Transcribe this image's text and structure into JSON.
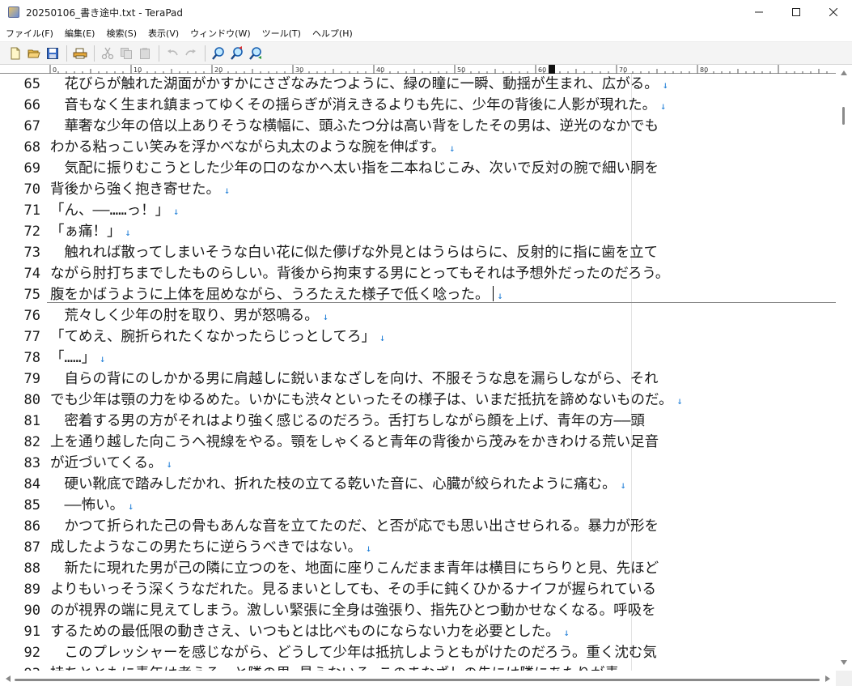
{
  "window": {
    "title": "20250106_書き途中.txt - TeraPad",
    "icon": "terapad-app-icon",
    "controls": [
      "minimize-icon",
      "maximize-icon",
      "close-icon"
    ]
  },
  "menu": [
    {
      "label": "ファイル(F)"
    },
    {
      "label": "編集(E)"
    },
    {
      "label": "検索(S)"
    },
    {
      "label": "表示(V)"
    },
    {
      "label": "ウィンドウ(W)"
    },
    {
      "label": "ツール(T)"
    },
    {
      "label": "ヘルプ(H)"
    }
  ],
  "toolbar": [
    {
      "icon": "new-file-icon",
      "enabled": true
    },
    {
      "icon": "open-folder-icon",
      "enabled": true
    },
    {
      "icon": "save-icon",
      "enabled": true
    },
    {
      "icon": "print-icon",
      "enabled": true
    },
    {
      "icon": "cut-icon",
      "enabled": false
    },
    {
      "icon": "copy-icon",
      "enabled": false
    },
    {
      "icon": "paste-icon",
      "enabled": false
    },
    {
      "icon": "undo-icon",
      "enabled": false
    },
    {
      "icon": "redo-icon",
      "enabled": false
    },
    {
      "icon": "search-icon",
      "enabled": true
    },
    {
      "icon": "search-previous-icon",
      "enabled": true
    },
    {
      "icon": "search-next-icon",
      "enabled": true
    }
  ],
  "ruler": {
    "labels": [
      "0",
      "10",
      "20",
      "30",
      "40",
      "50",
      "60",
      "70",
      "80"
    ],
    "marker_column": 62
  },
  "editor": {
    "newline_mark": "↓",
    "cursor_line": 75,
    "wrap_column": 72,
    "lines": [
      {
        "num": "65",
        "text": "　花びらが触れた湖面がかすかにさざなみたつように、緑の瞳に一瞬、動揺が生まれ、広がる。",
        "nl": true
      },
      {
        "num": "66",
        "text": "　音もなく生まれ鎮まってゆくその揺らぎが消えきるよりも先に、少年の背後に人影が現れた。",
        "nl": true
      },
      {
        "num": "67",
        "text": "　華奢な少年の倍以上ありそうな横幅に、頭ふたつ分は高い背をしたその男は、逆光のなかでも",
        "nl": false
      },
      {
        "num": "68",
        "text": "わかる粘っこい笑みを浮かべながら丸太のような腕を伸ばす。",
        "nl": true
      },
      {
        "num": "69",
        "text": "　気配に振りむこうとした少年の口のなかへ太い指を二本ねじこみ、次いで反対の腕で細い胴を",
        "nl": false
      },
      {
        "num": "70",
        "text": "背後から強く抱き寄せた。",
        "nl": true
      },
      {
        "num": "71",
        "text": "「ん、――……っ！」",
        "nl": true
      },
      {
        "num": "72",
        "text": "「ぁ痛！」",
        "nl": true
      },
      {
        "num": "73",
        "text": "　触れれば散ってしまいそうな白い花に似た儚げな外見とはうらはらに、反射的に指に歯を立て",
        "nl": false
      },
      {
        "num": "74",
        "text": "ながら肘打ちまでしたものらしい。背後から拘束する男にとってもそれは予想外だったのだろう。",
        "nl": false
      },
      {
        "num": "75",
        "text": "腹をかばうように上体を屈めながら、うろたえた様子で低く唸った。",
        "nl": true
      },
      {
        "num": "76",
        "text": "　荒々しく少年の肘を取り、男が怒鳴る。",
        "nl": true
      },
      {
        "num": "77",
        "text": "「てめえ、腕折られたくなかったらじっとしてろ」",
        "nl": true
      },
      {
        "num": "78",
        "text": "「……」",
        "nl": true
      },
      {
        "num": "79",
        "text": "　自らの背にのしかかる男に肩越しに鋭いまなざしを向け、不服そうな息を漏らしながら、それ",
        "nl": false
      },
      {
        "num": "80",
        "text": "でも少年は顎の力をゆるめた。いかにも渋々といったその様子は、いまだ抵抗を諦めないものだ。",
        "nl": true
      },
      {
        "num": "81",
        "text": "　密着する男の方がそれはより強く感じるのだろう。舌打ちしながら顔を上げ、青年の方――頭",
        "nl": false
      },
      {
        "num": "82",
        "text": "上を通り越した向こうへ視線をやる。顎をしゃくると青年の背後から茂みをかきわける荒い足音",
        "nl": false
      },
      {
        "num": "83",
        "text": "が近づいてくる。",
        "nl": true
      },
      {
        "num": "84",
        "text": "　硬い靴底で踏みしだかれ、折れた枝の立てる乾いた音に、心臓が絞られたように痛む。",
        "nl": true
      },
      {
        "num": "85",
        "text": "　――怖い。",
        "nl": true
      },
      {
        "num": "86",
        "text": "　かつて折られた己の骨もあんな音を立てたのだ、と否が応でも思い出させられる。暴力が形を",
        "nl": false
      },
      {
        "num": "87",
        "text": "成したようなこの男たちに逆らうべきではない。",
        "nl": true
      },
      {
        "num": "88",
        "text": "　新たに現れた男が己の隣に立つのを、地面に座りこんだまま青年は横目にちらりと見、先ほど",
        "nl": false
      },
      {
        "num": "89",
        "text": "よりもいっそう深くうなだれた。見るまいとしても、その手に鈍くひかるナイフが握られている",
        "nl": false
      },
      {
        "num": "90",
        "text": "のが視界の端に見えてしまう。激しい緊張に全身は強張り、指先ひとつ動かせなくなる。呼吸を",
        "nl": false
      },
      {
        "num": "91",
        "text": "するための最低限の動きさえ、いつもとは比べものにならない力を必要とした。",
        "nl": true
      },
      {
        "num": "92",
        "text": "　このプレッシャーを感じながら、どうして少年は抵抗しようともがけたのだろう。重く沈む気",
        "nl": false
      },
      {
        "num": "93",
        "text": "持ちとともに青年は考える。と隣の男…見えないる…このまなざしの先には隣にあたりが青",
        "nl": false
      }
    ]
  }
}
